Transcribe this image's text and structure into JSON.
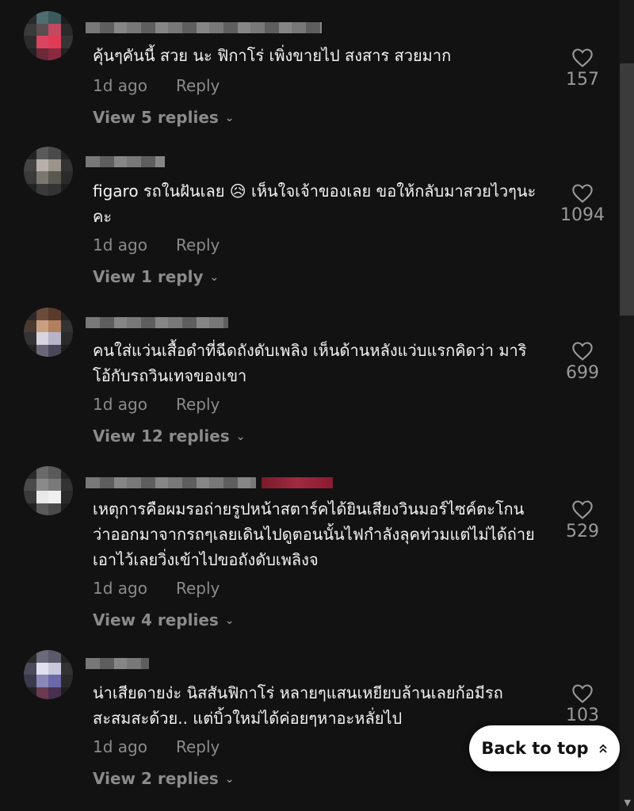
{
  "comments": [
    {
      "text": "คุ้นๆคันนี้ สวย นะ ฟิกาโร่ เพิ่งขายไป สงสาร สวยมาก",
      "time": "1d ago",
      "reply": "Reply",
      "view_replies": "View 5 replies",
      "likes": "157"
    },
    {
      "text": "figaro รถในฝันเลย 😥 เห็นใจเจ้าของเลย ขอให้กลับมาสวยไวๆนะคะ",
      "time": "1d ago",
      "reply": "Reply",
      "view_replies": "View 1 reply",
      "likes": "1094"
    },
    {
      "text": "คนใส่แว่นเสื้อดำที่ฉีดถังดับเพลิง เห็นด้านหลังแว่บแรกคิดว่า มาริโอ้กับรถวินเทจของเขา",
      "time": "1d ago",
      "reply": "Reply",
      "view_replies": "View 12 replies",
      "likes": "699"
    },
    {
      "text": "เหตุการคือผมรอถ่ายรูปหน้าสตาร์คได้ยินเสียงวินมอร์ไซค์ตะโกนว่าออกมาจากรถๆเลยเดินไปดูตอนนั้นไฟกำลังลุคท่วมแต่ไม่ได้ถ่ายเอาไว้เลยวิ่งเข้าไปขอถังดับเพลิงจ",
      "time": "1d ago",
      "reply": "Reply",
      "view_replies": "View 4 replies",
      "likes": "529"
    },
    {
      "text": "น่าเสียดายง่ะ นิสสันฟิกาโร่ หลายๆแสนเหยียบล้านเลยก้อมีรถสะสมสะด้วย.. แต่บิ้วใหม่ได้ค่อยๆหาอะหลั่ยไป",
      "time": "1d ago",
      "reply": "Reply",
      "view_replies": "View 2 replies",
      "likes": "103"
    }
  ],
  "back_to_top": "Back to top",
  "icons": {
    "like": "heart-icon",
    "expand": "chevron-down-icon",
    "up": "double-chevron-up-icon"
  }
}
